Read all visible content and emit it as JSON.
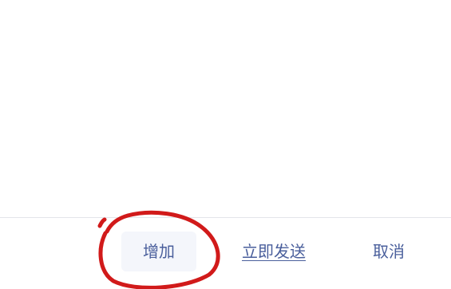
{
  "dialog": {
    "actions": {
      "add_label": "增加",
      "send_now_label": "立即发送",
      "cancel_label": "取消"
    }
  },
  "colors": {
    "button_text": "#4a5f9c",
    "add_button_bg": "#f4f6fb",
    "divider": "#e3e5ea",
    "annotation_stroke": "#d11a1a"
  }
}
